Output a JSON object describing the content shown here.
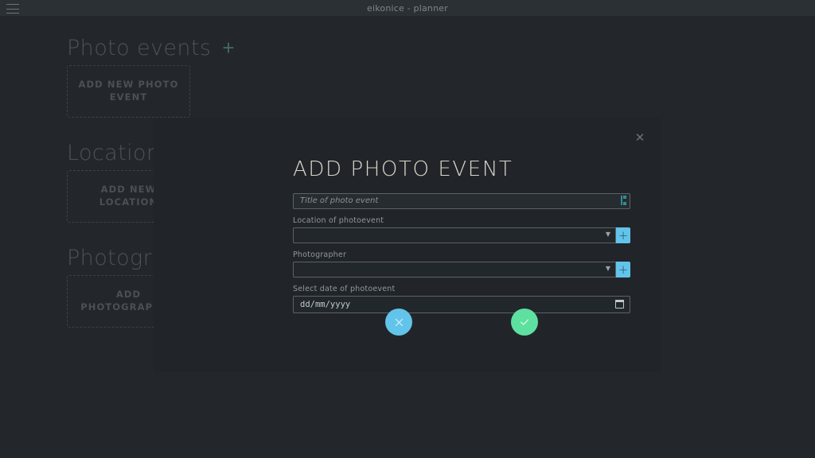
{
  "window": {
    "title": "eikonice - planner",
    "menu_icon": "hamburger-icon"
  },
  "sidebar": {
    "sections": [
      {
        "title": "Photo events",
        "add_icon": "plus-icon",
        "card_label": "ADD NEW PHOTO EVENT"
      },
      {
        "title": "Locations",
        "card_label": "ADD NEW LOCATION"
      },
      {
        "title": "Photographers",
        "card_label": "ADD PHOTOGRAPHER"
      }
    ]
  },
  "modal": {
    "title": "ADD PHOTO EVENT",
    "close_icon": "close-icon",
    "fields": {
      "title": {
        "placeholder": "Title of photo event",
        "value": "",
        "badge_icon": "text-cursor-icon"
      },
      "location": {
        "label": "Location of photoevent",
        "value": "",
        "chevron_icon": "chevron-down-icon",
        "add_button_label": "+"
      },
      "photographer": {
        "label": "Photographer",
        "value": "",
        "chevron_icon": "chevron-down-icon",
        "add_button_label": "+"
      },
      "date": {
        "label": "Select date of photoevent",
        "placeholder": "dd/mm/yyyy",
        "value": "dd/mm/yyyy",
        "picker_icon": "calendar-icon"
      }
    },
    "actions": {
      "cancel_icon": "close-x-icon",
      "confirm_icon": "check-icon"
    }
  },
  "colors": {
    "page_background": "#23272b",
    "titlebar_background": "#2b3035",
    "modal_background": "#21252a",
    "accent_blue": "#62c4ea",
    "accent_green": "#5ee0a0",
    "accent_teal": "#3e6a63",
    "title_cream": "#d9d6c9"
  }
}
